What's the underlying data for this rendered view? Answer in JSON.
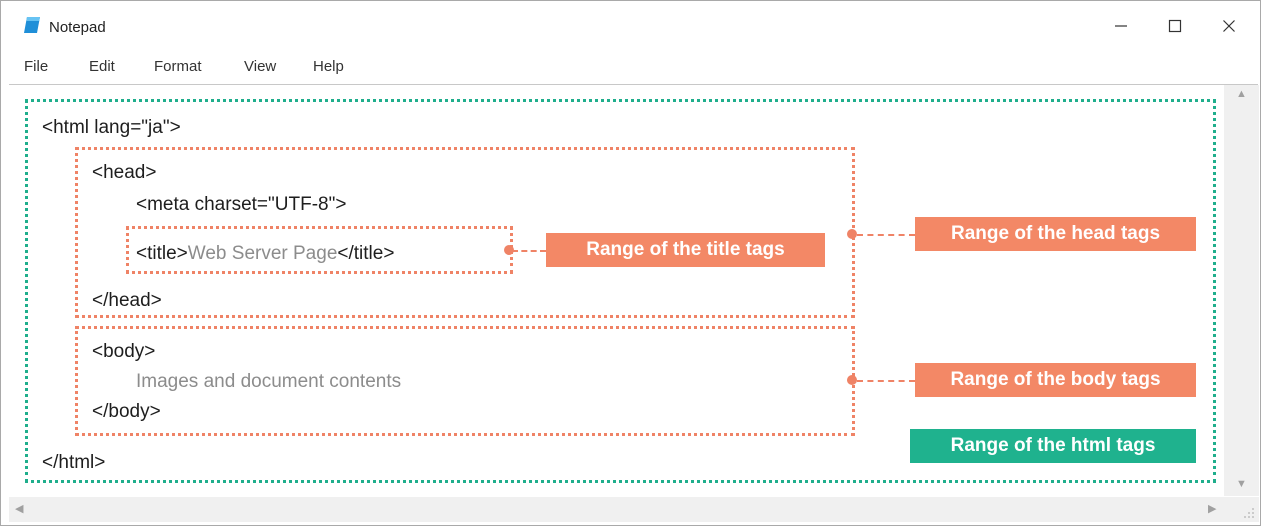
{
  "window": {
    "title": "Notepad",
    "controls": {
      "minimize": "—",
      "maximize": "☐",
      "close": "✕"
    }
  },
  "menu": {
    "items": [
      "File",
      "Edit",
      "Format",
      "View",
      "Help"
    ]
  },
  "editor": {
    "lines": {
      "html_open": "<html lang=\"ja\">",
      "head_open": "<head>",
      "meta": "<meta charset=\"UTF-8\">",
      "title_open": "<title>",
      "title_text": "Web Server Page",
      "title_close": "</title>",
      "head_close": "</head>",
      "body_open": "<body>",
      "body_text": "Images and document contents",
      "body_close": "</body>",
      "html_close": "</html>"
    }
  },
  "annotations": {
    "title": "Range of the title tags",
    "head": "Range of the head tags",
    "body": "Range of the body tags",
    "html": "Range of the html tags",
    "colors": {
      "orange": "#f38866",
      "green": "#1fb28e"
    }
  },
  "scrollbars": {
    "up": "▲",
    "down": "▼",
    "left": "◀",
    "right": "▶"
  }
}
